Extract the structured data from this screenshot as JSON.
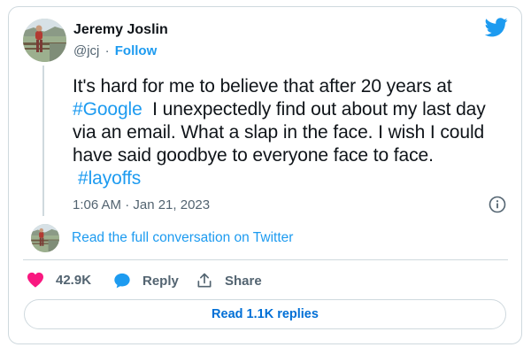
{
  "author": {
    "name": "Jeremy Joslin",
    "handle": "@jcj",
    "separator": "·",
    "follow_label": "Follow"
  },
  "tweet": {
    "line1": "It's hard for me to believe that after 20 years at",
    "hashtag1": "#Google",
    "line2_rest": "  I unexpectedly find out about my last day",
    "line3": "via an email. What a slap in the face. I wish I could",
    "line4": "have said goodbye to everyone face to face.",
    "hashtag2": "#layoffs",
    "timestamp": "1:06 AM · Jan 21, 2023"
  },
  "conversation": {
    "label": "Read the full conversation on Twitter"
  },
  "actions": {
    "like_count": "42.9K",
    "reply_label": "Reply",
    "share_label": "Share"
  },
  "replies_button": {
    "label": "Read 1.1K replies"
  },
  "icons": {
    "brand": "twitter-bird-icon",
    "info": "info-icon",
    "like": "heart-icon",
    "reply": "speech-bubble-icon",
    "share": "share-upload-icon"
  },
  "colors": {
    "link": "#1d9bf0",
    "heart": "#f91880",
    "text": "#0f1419",
    "muted": "#536471",
    "border": "#cfd9de"
  }
}
